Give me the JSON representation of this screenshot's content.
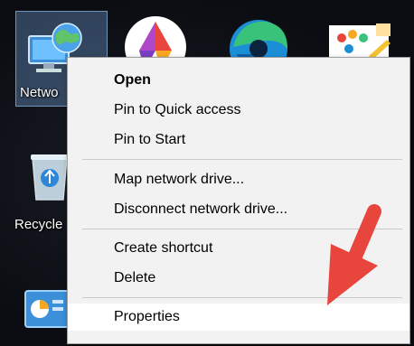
{
  "desktop": {
    "icons": {
      "network_label": "Netwo",
      "recycle_label": "Recycle"
    }
  },
  "context_menu": {
    "items": [
      {
        "label": "Open",
        "bold": true
      },
      {
        "label": "Pin to Quick access"
      },
      {
        "label": "Pin to Start"
      },
      {
        "label": "Map network drive..."
      },
      {
        "label": "Disconnect network drive..."
      },
      {
        "label": "Create shortcut"
      },
      {
        "label": "Delete"
      },
      {
        "label": "Properties",
        "hovered": true
      }
    ]
  },
  "colors": {
    "annotation_arrow": "#e8453c",
    "menu_background": "#f2f2f2",
    "selection_highlight": "#78aae6"
  }
}
